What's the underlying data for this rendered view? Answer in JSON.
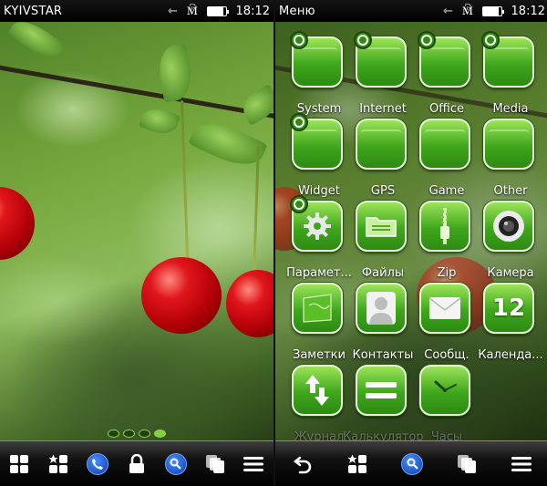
{
  "left_screen": {
    "statusbar": {
      "operator": "KYIVSTAR",
      "time": "18:12"
    },
    "page_dots": {
      "count": 4,
      "active_index": 3
    },
    "toolbar": [
      "apps-grid-icon",
      "favorites-icon",
      "phone-icon",
      "lock-icon",
      "search-icon",
      "task-switcher-icon",
      "menu-icon"
    ]
  },
  "right_screen": {
    "statusbar": {
      "title": "Меню",
      "time": "18:12"
    },
    "menu": {
      "items": [
        {
          "label": "System",
          "icon": "folder-icon",
          "badge": true
        },
        {
          "label": "Internet",
          "icon": "folder-icon",
          "badge": true
        },
        {
          "label": "Office",
          "icon": "folder-icon",
          "badge": true
        },
        {
          "label": "Media",
          "icon": "folder-icon",
          "badge": true
        },
        {
          "label": "Widget",
          "icon": "folder-icon",
          "badge": true
        },
        {
          "label": "GPS",
          "icon": "folder-icon",
          "badge": false
        },
        {
          "label": "Game",
          "icon": "folder-icon",
          "badge": false
        },
        {
          "label": "Other",
          "icon": "folder-icon",
          "badge": false
        },
        {
          "label": "Парамет...",
          "icon": "gear-icon",
          "badge": true
        },
        {
          "label": "Файлы",
          "icon": "file-manager-icon",
          "badge": false
        },
        {
          "label": "Zip",
          "icon": "zip-icon",
          "badge": false
        },
        {
          "label": "Камера",
          "icon": "camera-icon",
          "badge": false
        },
        {
          "label": "Заметки",
          "icon": "notes-icon",
          "badge": false
        },
        {
          "label": "Контакты",
          "icon": "contacts-icon",
          "badge": false
        },
        {
          "label": "Сообщ.",
          "icon": "messaging-icon",
          "badge": false
        },
        {
          "label": "Календа...",
          "icon": "calendar-icon",
          "badge": false,
          "value": "12"
        },
        {
          "label": "Журнал",
          "icon": "log-icon",
          "badge": false,
          "faded": true
        },
        {
          "label": "Калькулятор",
          "icon": "calculator-icon",
          "badge": false,
          "faded": true
        },
        {
          "label": "Часы",
          "icon": "clock-icon",
          "badge": false,
          "faded": true
        }
      ]
    },
    "toolbar": [
      "back-icon",
      "favorites-icon",
      "search-icon",
      "task-switcher-icon",
      "menu-icon"
    ]
  },
  "colors": {
    "accent_green": "#3fa61c",
    "tile_border": "#e9f5de",
    "search_blue": "#0a3ea8"
  }
}
